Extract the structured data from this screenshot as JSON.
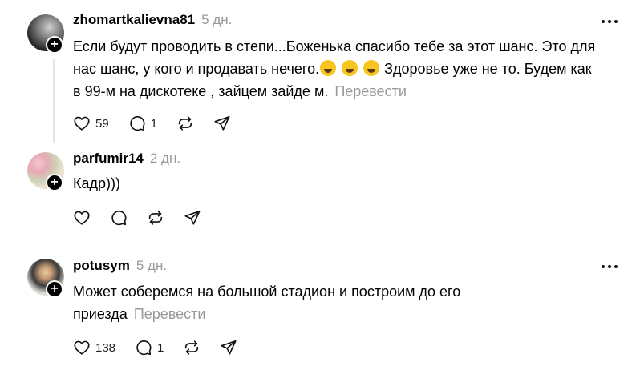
{
  "comments": [
    {
      "username": "zhomartkalievna81",
      "time": "5 дн.",
      "text_line1": "Если будут проводить в степи...Боженька спасибо тебе за этот шанс. Это для",
      "text_line2_a": "нас шанс, у кого и продавать нечего.",
      "text_line2_b": " Здоровье уже не то. Будем как",
      "text_line3": "в 99-м на дискотеке , зайцем зайде м.",
      "translate": "Перевести",
      "likes": "59",
      "replies": "1"
    },
    {
      "username": "parfumir14",
      "time": "2 дн.",
      "text_line1": "Кадр)))"
    },
    {
      "username": "potusym",
      "time": "5 дн.",
      "text_line1": "Может соберемся на большой стадион и построим до его",
      "text_line2": "приезда",
      "translate": "Перевести",
      "likes": "138",
      "replies": "1"
    }
  ],
  "follow_badge": "+",
  "icons": [
    "heart-icon",
    "comment-icon",
    "repost-icon",
    "share-icon",
    "more-icon"
  ],
  "colors": {
    "muted": "#999999",
    "badge": "#000000",
    "divider": "#dcdcdc"
  }
}
